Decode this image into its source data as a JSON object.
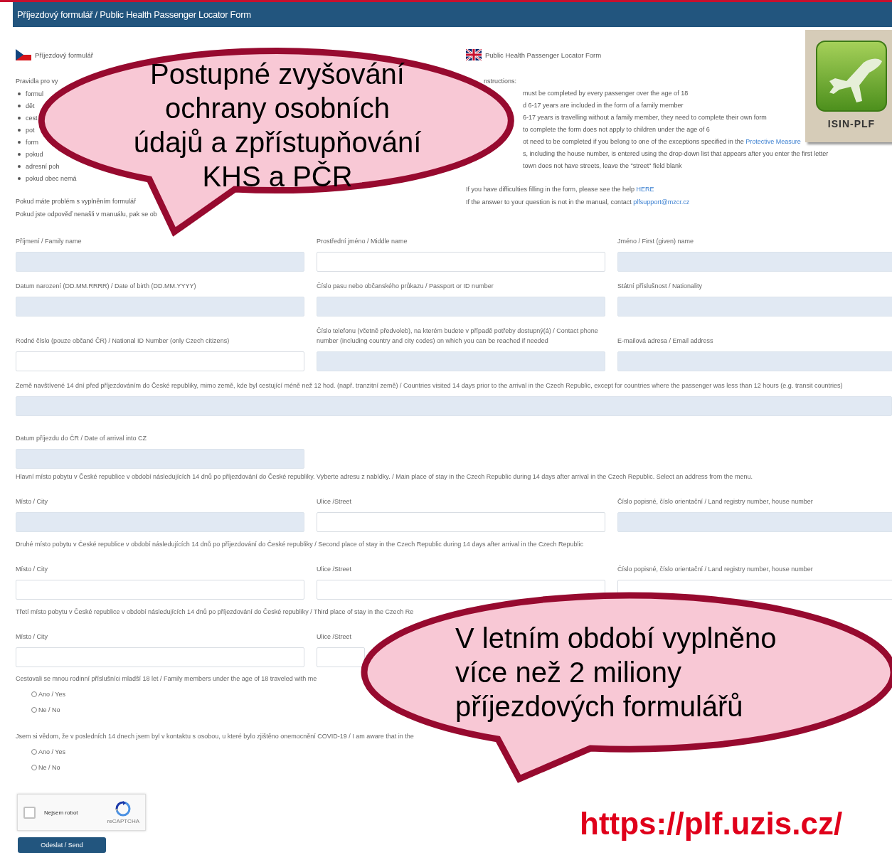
{
  "header": {
    "title": "Příjezdový formulář / Public Health Passenger Locator Form"
  },
  "intro_cz": {
    "heading": "Příjezdový formulář",
    "rules_label": "Pravidla pro vy",
    "bullets": [
      "formul",
      "dět",
      "cest",
      "pot",
      "form",
      "pokud",
      "adresní poh",
      "pokud obec nemá"
    ],
    "notes": [
      "Pokud máte problém s vyplněním formulář",
      "Pokud jste odpověď nenašli v manuálu, pak se ob"
    ]
  },
  "intro_en": {
    "heading": "Public Health Passenger Locator Form",
    "rules_label": "nstructions:",
    "lines": [
      {
        "text": "must be completed by every passenger over the age of 18"
      },
      {
        "text": "d 6-17 years are included in the form of a family member"
      },
      {
        "text": "6-17 years is travelling without a family member, they need to complete their own form"
      },
      {
        "text": "to complete the form does not apply to children under the age of 6"
      },
      {
        "text": "ot need to be completed if you belong to one of the exceptions specified in the ",
        "link": "Protective Measure"
      },
      {
        "text": "s, including the house number, is entered using the drop-down list that appears after you enter the first letter"
      },
      {
        "text": "town does not have streets, leave the \"street\" field blank"
      }
    ],
    "notes": [
      {
        "text": "If you have difficulties filling in the form, please see the help ",
        "link": "HERE"
      },
      {
        "text": "If the answer to your question is not in the manual, contact ",
        "link": "plfsupport@mzcr.cz"
      }
    ]
  },
  "logo": {
    "label": "ISIN-PLF"
  },
  "form": [
    {
      "kind": "row",
      "fields": [
        {
          "label": "Příjmení / Family name",
          "shaded": true
        },
        {
          "label": "Prostřední jméno / Middle name",
          "shaded": false
        },
        {
          "label": "Jméno / First (given) name",
          "shaded": true
        }
      ]
    },
    {
      "kind": "row",
      "fields": [
        {
          "label": "Datum narození (DD.MM.RRRR) / Date of birth (DD.MM.YYYY)",
          "shaded": true
        },
        {
          "label": "Číslo pasu nebo občanského průkazu / Passport or ID number",
          "shaded": true
        },
        {
          "label": "Státní příslušnost / Nationality",
          "shaded": true
        }
      ]
    },
    {
      "kind": "row",
      "fields": [
        {
          "label": "Rodné číslo (pouze občané ČR) / National ID Number (only Czech citizens)",
          "shaded": false
        },
        {
          "label": "Číslo telefonu (včetně předvoleb), na kterém budete v případě potřeby dostupný(á) / Contact phone number (including country and city codes) on which you can be reached if needed",
          "shaded": true
        },
        {
          "label": "E-mailová adresa / Email address",
          "shaded": true
        }
      ]
    },
    {
      "kind": "wide",
      "label": "Země navštívené 14 dní před příjezdováním do České republiky, mimo země, kde byl cestující méně než 12 hod. (např. tranzitní země) / Countries visited 14 days prior to the arrival in the Czech Republic, except for countries where the passenger was less than 12 hours (e.g. transit countries)",
      "shaded": true
    },
    {
      "kind": "row",
      "fields": [
        {
          "label": "Datum příjezdu do ČR / Date of arrival into CZ",
          "shaded": true
        }
      ]
    },
    {
      "kind": "section",
      "text": "Hlavní místo pobytu v České republice v období následujících 14 dnů po příjezdování do České republiky. Vyberte adresu z nabídky. / Main place of stay in the Czech Republic during 14 days after arrival in the Czech Republic. Select an address from the menu."
    },
    {
      "kind": "row",
      "fields": [
        {
          "label": "Místo / City",
          "shaded": true
        },
        {
          "label": "Ulice /Street",
          "shaded": false
        },
        {
          "label": "Číslo popisné, číslo orientační / Land registry number, house number",
          "shaded": true
        }
      ]
    },
    {
      "kind": "section",
      "text": "Druhé místo pobytu v České republice v období následujících 14 dnů po příjezdování do České republiky / Second place of stay in the Czech Republic during 14 days after arrival in the Czech Republic"
    },
    {
      "kind": "row",
      "fields": [
        {
          "label": "Místo / City",
          "shaded": false
        },
        {
          "label": "Ulice /Street",
          "shaded": false
        },
        {
          "label": "Číslo popisné, číslo orientační / Land registry number, house number",
          "shaded": false
        }
      ]
    },
    {
      "kind": "section",
      "text": "Třetí místo pobytu v České republice v období následujících 14 dnů po příjezdování do České republiky / Third place of stay in the Czech Re"
    },
    {
      "kind": "row",
      "fields": [
        {
          "label": "Místo / City",
          "shaded": false
        },
        {
          "label": "Ulice /Street",
          "shaded": false
        }
      ]
    },
    {
      "kind": "question",
      "label": "Cestovali se mnou rodinní příslušníci mladší 18 let / Family members under the age of 18 traveled with me",
      "options": [
        {
          "label": "Ano / Yes",
          "selected": false
        },
        {
          "label": "Ne / No",
          "selected": false
        }
      ]
    },
    {
      "kind": "question",
      "label": "Jsem si vědom, že v posledních 14 dnech jsem byl v kontaktu s osobou, u které bylo zjištěno onemocnění COVID-19 / I am aware that in the",
      "options": [
        {
          "label": "Ano / Yes",
          "selected": false
        },
        {
          "label": "Ne / No",
          "selected": false
        }
      ]
    }
  ],
  "captcha": {
    "label": "Nejsem robot",
    "checked": false,
    "brand": "reCAPTCHA"
  },
  "submit": "Odeslat / Send",
  "callouts": [
    {
      "text": "Postupné zvyšování\nochrany osobních\núdajů a zpřístupňování\nKHS a PČR"
    },
    {
      "text": "V letním období vyplněno\nvíce než 2 miliony\npříjezdových formulářů"
    }
  ],
  "url": "https://plf.uzis.cz/"
}
